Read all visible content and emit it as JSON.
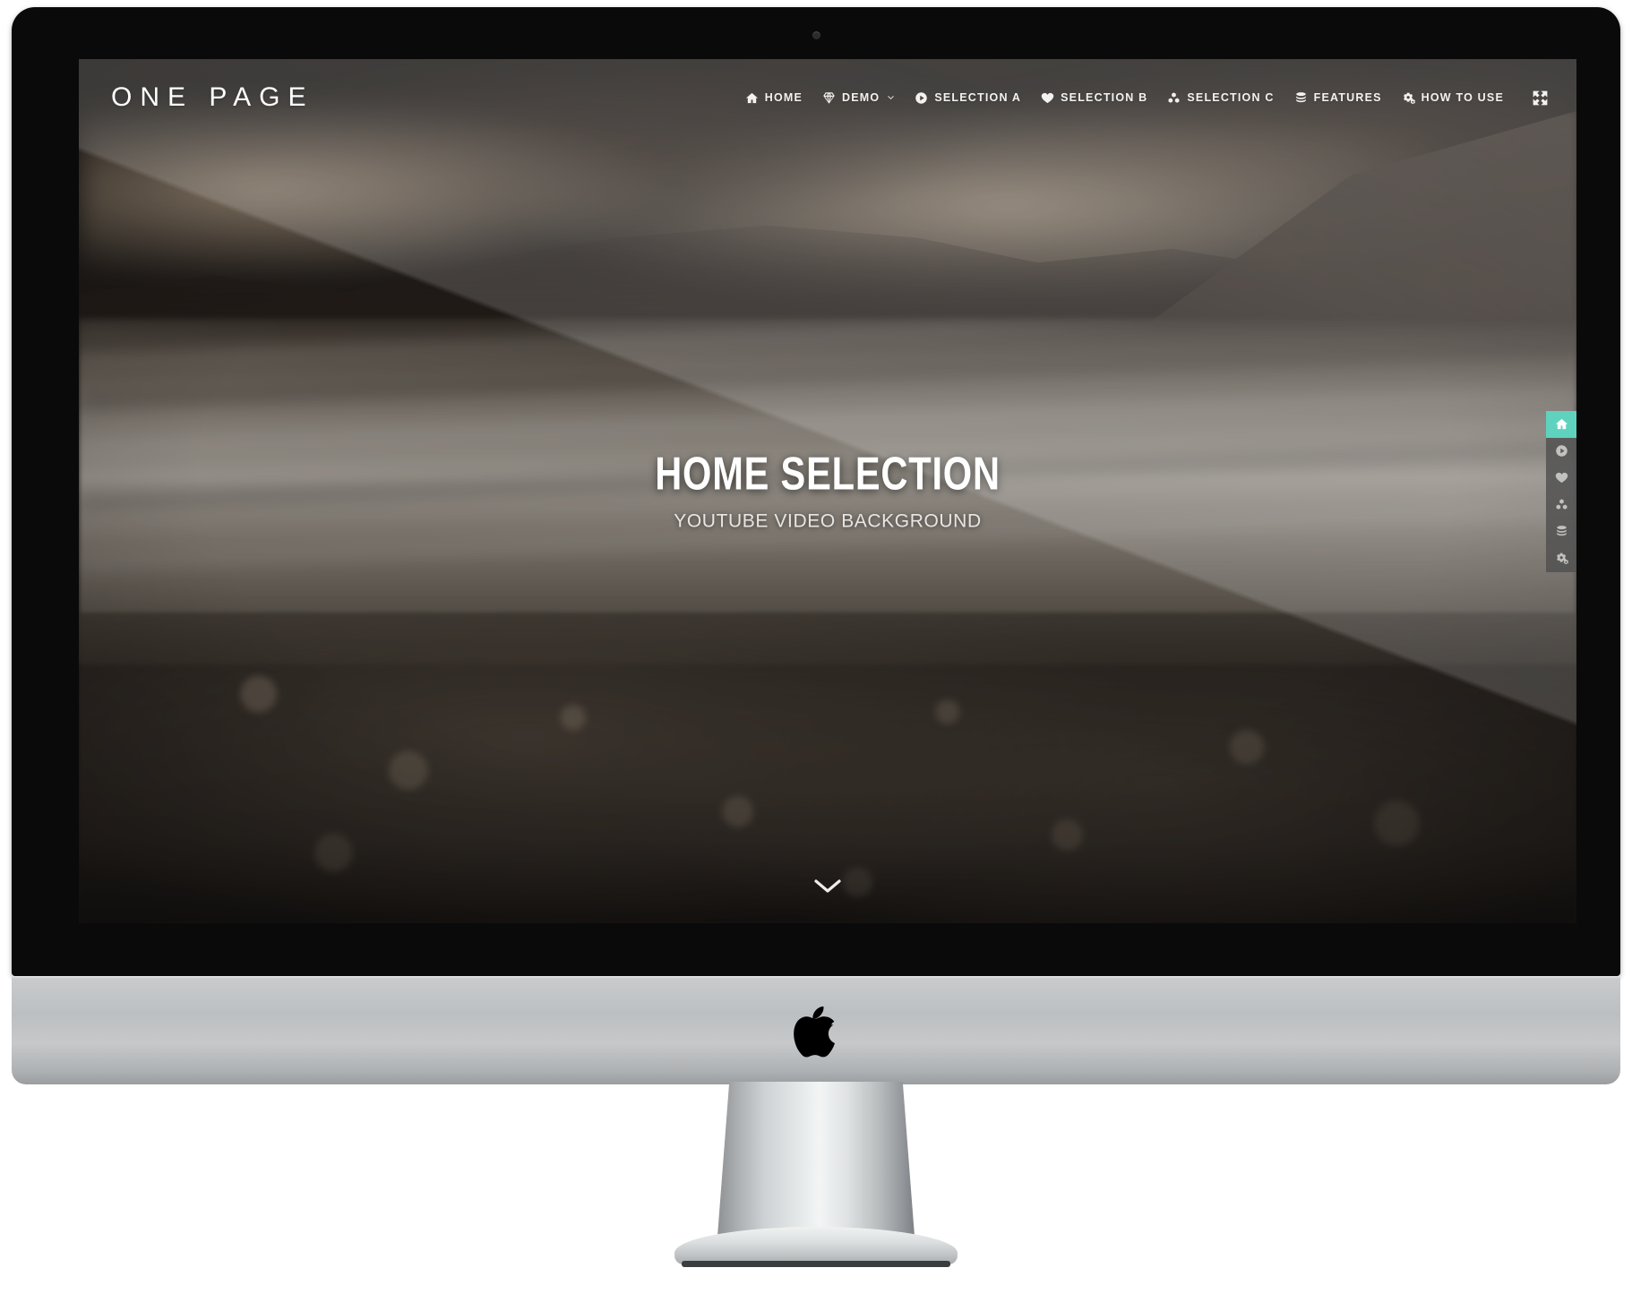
{
  "device": {
    "name": "iMac",
    "logo_icon": "apple-logo-icon",
    "camera_icon": "facetime-camera-icon"
  },
  "site": {
    "brand": "ONE PAGE",
    "nav": [
      {
        "label": "HOME",
        "icon": "home-icon",
        "active": true,
        "has_caret": false
      },
      {
        "label": "DEMO",
        "icon": "gem-icon",
        "active": false,
        "has_caret": true
      },
      {
        "label": "SELECTION A",
        "icon": "play-circle-icon",
        "active": false,
        "has_caret": false
      },
      {
        "label": "SELECTION B",
        "icon": "heart-icon",
        "active": false,
        "has_caret": false
      },
      {
        "label": "SELECTION C",
        "icon": "cubes-icon",
        "active": false,
        "has_caret": false
      },
      {
        "label": "FEATURES",
        "icon": "database-icon",
        "active": false,
        "has_caret": false
      },
      {
        "label": "HOW TO USE",
        "icon": "gears-icon",
        "active": false,
        "has_caret": false
      }
    ],
    "fullscreen_icon": "expand-arrows-icon",
    "hero": {
      "title": "HOME SELECTION",
      "subtitle": "YOUTUBE VIDEO BACKGROUND"
    },
    "side_nav": [
      {
        "name": "home",
        "icon": "home-icon",
        "active": true
      },
      {
        "name": "selection-a",
        "icon": "play-circle-icon",
        "active": false
      },
      {
        "name": "selection-b",
        "icon": "heart-icon",
        "active": false
      },
      {
        "name": "selection-c",
        "icon": "cubes-icon",
        "active": false
      },
      {
        "name": "features",
        "icon": "database-icon",
        "active": false
      },
      {
        "name": "how-to-use",
        "icon": "gears-icon",
        "active": false
      }
    ],
    "scroll_indicator_icon": "chevron-down-icon",
    "colors": {
      "accent": "#3cc9b0",
      "side_nav_bg": "#2e2e2e",
      "nav_text": "#f2efec",
      "hero_text": "#ffffff"
    }
  }
}
